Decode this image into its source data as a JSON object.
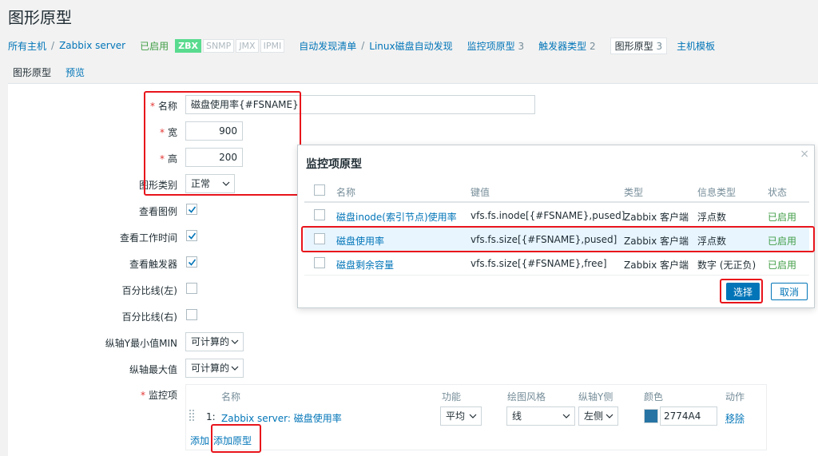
{
  "page": {
    "title": "图形原型"
  },
  "breadcrumb": {
    "all_hosts": "所有主机",
    "host": "Zabbix server",
    "status": "已启用",
    "badges": [
      "ZBX",
      "SNMP",
      "JMX",
      "IPMI"
    ],
    "discovery_list": "自动发现清单",
    "discovery_rule": "Linux磁盘自动发现",
    "item_prototypes": "监控项原型",
    "item_prototypes_count": "3",
    "trigger_prototypes": "触发器类型",
    "trigger_prototypes_count": "2",
    "graph_prototypes": "图形原型",
    "graph_prototypes_count": "3",
    "host_prototypes": "主机模板"
  },
  "tabs": [
    "图形原型",
    "预览"
  ],
  "form": {
    "name_label": "名称",
    "name_value": "磁盘使用率{#FSNAME}",
    "width_label": "宽",
    "width_value": "900",
    "height_label": "高",
    "height_value": "200",
    "graph_type_label": "图形类别",
    "graph_type_value": "正常",
    "show_legend_label": "查看图例",
    "show_legend_checked": true,
    "show_work_period_label": "查看工作时间",
    "show_work_period_checked": true,
    "show_triggers_label": "查看触发器",
    "show_triggers_checked": true,
    "percentile_left_label": "百分比线(左)",
    "percentile_left_checked": false,
    "percentile_right_label": "百分比线(右)",
    "percentile_right_checked": false,
    "ymin_label": "纵轴Y最小值MIN",
    "ymin_value": "可计算的",
    "ymax_label": "纵轴最大值",
    "ymax_value": "可计算的",
    "items_label": "监控项"
  },
  "items_table": {
    "headers": [
      "名称",
      "功能",
      "绘图风格",
      "纵轴Y侧",
      "颜色",
      "动作"
    ],
    "rows": [
      {
        "num": "1:",
        "name": "Zabbix server: 磁盘使用率",
        "function": "平均",
        "draw_style": "线",
        "y_side": "左侧",
        "color": "2774A4",
        "action": "移除"
      }
    ],
    "add_link": "添加",
    "add_prototype_link": "添加原型"
  },
  "modal": {
    "title": "监控项原型",
    "close": "×",
    "headers": [
      "名称",
      "键值",
      "类型",
      "信息类型",
      "状态"
    ],
    "rows": [
      {
        "name": "磁盘inode(索引节点)使用率",
        "key": "vfs.fs.inode[{#FSNAME},pused]",
        "type": "Zabbix 客户端",
        "info_type": "浮点数",
        "status": "已启用"
      },
      {
        "name": "磁盘使用率",
        "key": "vfs.fs.size[{#FSNAME},pused]",
        "type": "Zabbix 客户端",
        "info_type": "浮点数",
        "status": "已启用"
      },
      {
        "name": "磁盘剩余容量",
        "key": "vfs.fs.size[{#FSNAME},free]",
        "type": "Zabbix 客户端",
        "info_type": "数字 (无正负)",
        "status": "已启用"
      }
    ],
    "select_button": "选择",
    "cancel_button": "取消"
  },
  "colors": {
    "accent": "#0275b8",
    "enabled": "#429e47",
    "highlight": "#e8141b",
    "item_color": "#2774A4"
  }
}
